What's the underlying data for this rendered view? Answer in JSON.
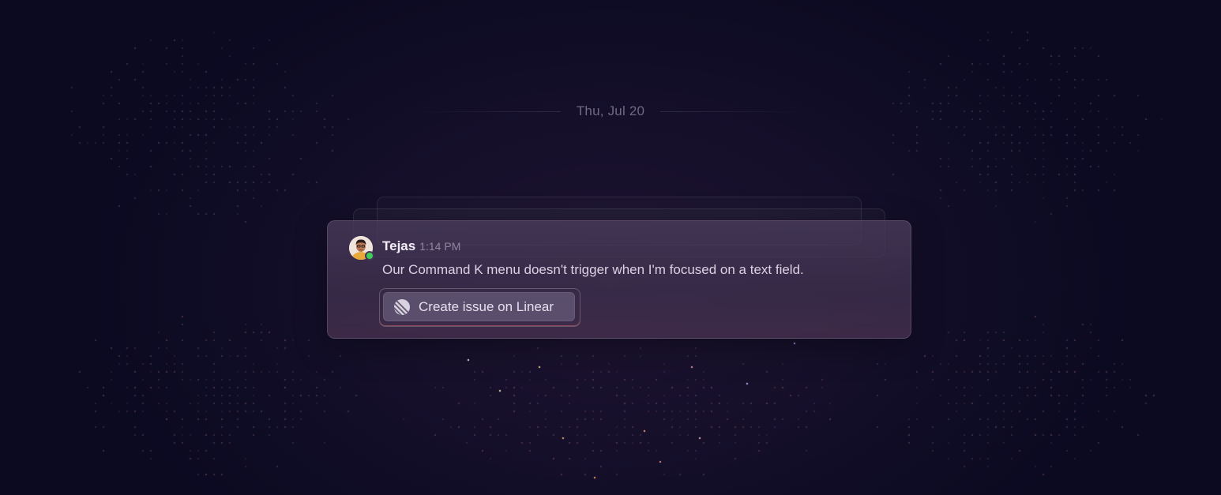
{
  "date_divider": {
    "label": "Thu, Jul 20"
  },
  "message": {
    "author": "Tejas",
    "timestamp": "1:14 PM",
    "text": "Our Command K menu doesn't trigger when I'm focused on a text field.",
    "avatar_icon": "user-avatar",
    "presence_status_color": "#3ecf5a"
  },
  "action": {
    "label": "Create issue on Linear",
    "icon": "linear-logo-icon"
  },
  "colors": {
    "background": "#0c0a22",
    "card": "#43365a",
    "accent_glow": "#f0786e"
  }
}
